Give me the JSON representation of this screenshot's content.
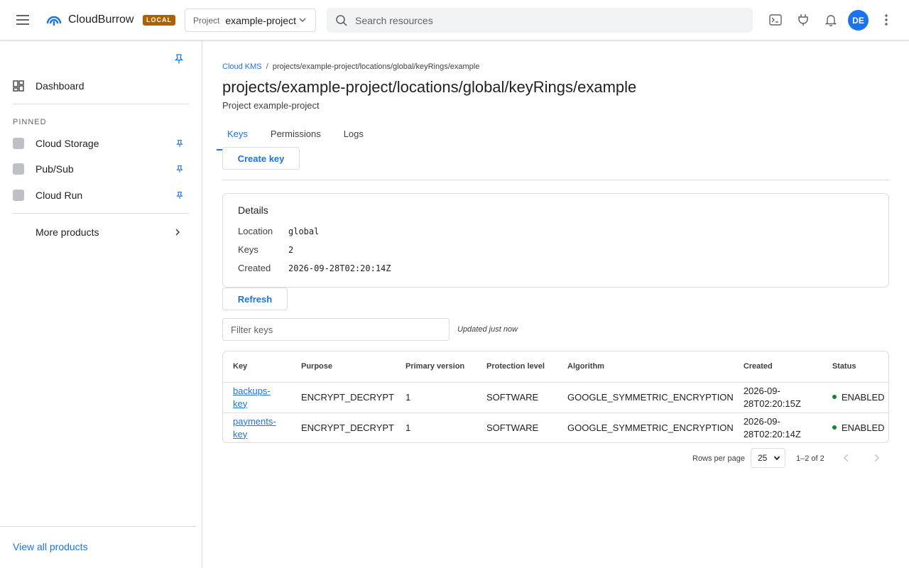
{
  "app": {
    "name": "CloudBurrow",
    "badge": "LOCAL",
    "project_label": "Project",
    "project_value": "example-project",
    "search_placeholder": "Search resources",
    "avatar": "DE",
    "accent": "#1a73e8",
    "badge_color": "#b06000"
  },
  "sidebar": {
    "dashboard": "Dashboard",
    "pinned_label": "PINNED",
    "pinned_items": [
      {
        "label": "Cloud Storage"
      },
      {
        "label": "Pub/Sub"
      },
      {
        "label": "Cloud Run"
      }
    ],
    "more_products": "More products",
    "view_all": "View all products"
  },
  "main": {
    "breadcrumb": {
      "root": "Cloud KMS",
      "separator": "/",
      "current": "projects/example-project/locations/global/keyRings/example"
    },
    "title": "projects/example-project/locations/global/keyRings/example",
    "subtitle": "Project example-project",
    "tabs": [
      {
        "label": "Keys",
        "active": true
      },
      {
        "label": "Permissions",
        "active": false
      },
      {
        "label": "Logs",
        "active": false
      }
    ],
    "create_button": "Create key",
    "details": {
      "heading": "Details",
      "rows": [
        {
          "key": "Location",
          "value": "global"
        },
        {
          "key": "Keys",
          "value": "2"
        },
        {
          "key": "Created",
          "value": "2026-09-28T02:20:14Z"
        }
      ]
    },
    "refresh_button": "Refresh",
    "filter_placeholder": "Filter keys",
    "updated_text": "Updated just now",
    "table": {
      "columns": [
        "Key",
        "Purpose",
        "Primary version",
        "Protection level",
        "Algorithm",
        "Created",
        "Status"
      ],
      "rows": [
        {
          "key": "backups-key",
          "purpose": "ENCRYPT_DECRYPT",
          "primary_version": "1",
          "protection_level": "SOFTWARE",
          "algorithm": "GOOGLE_SYMMETRIC_ENCRYPTION",
          "created": "2026-09-28T02:20:15Z",
          "status": "ENABLED"
        },
        {
          "key": "payments-key",
          "purpose": "ENCRYPT_DECRYPT",
          "primary_version": "1",
          "protection_level": "SOFTWARE",
          "algorithm": "GOOGLE_SYMMETRIC_ENCRYPTION",
          "created": "2026-09-28T02:20:14Z",
          "status": "ENABLED"
        }
      ],
      "status_color": "#188038"
    },
    "pagination": {
      "rows_per_page_label": "Rows per page",
      "rows_per_page": "25",
      "range": "1–2 of 2"
    }
  }
}
